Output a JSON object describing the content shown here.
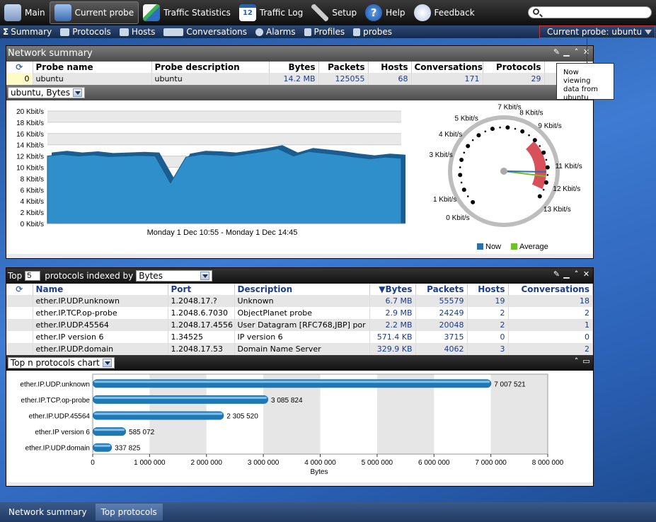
{
  "nav": {
    "items": [
      {
        "label": "Main",
        "icon": "house-icon"
      },
      {
        "label": "Current probe",
        "icon": "monitor-icon",
        "active": true
      },
      {
        "label": "Traffic Statistics",
        "icon": "chart-icon"
      },
      {
        "label": "Traffic Log",
        "icon": "calendar-icon"
      },
      {
        "label": "Setup",
        "icon": "wrench-icon"
      },
      {
        "label": "Help",
        "icon": "help-icon"
      },
      {
        "label": "Feedback",
        "icon": "speech-bubble-icon"
      }
    ],
    "search_placeholder": ""
  },
  "subnav": {
    "items": [
      {
        "label": "Summary",
        "icon": "sigma-icon"
      },
      {
        "label": "Protocols",
        "icon": "protocols-icon"
      },
      {
        "label": "Hosts",
        "icon": "hosts-icon"
      },
      {
        "label": "Conversations",
        "icon": "conversations-icon"
      },
      {
        "label": "Alarms",
        "icon": "alarm-clock-icon"
      },
      {
        "label": "Profiles",
        "icon": "profiles-icon"
      },
      {
        "label": "probes",
        "icon": "probes-icon"
      }
    ],
    "current_probe": "Current probe: ubuntu"
  },
  "tooltip": "Now viewing data from ubuntu",
  "network_summary": {
    "title": "Network summary",
    "columns": [
      "Probe name",
      "Probe description",
      "Bytes",
      "Packets",
      "Hosts",
      "Conversations",
      "Protocols"
    ],
    "row": {
      "index": "0",
      "name": "ubuntu",
      "description": "ubuntu",
      "bytes": "14.2 MB",
      "packets": "125055",
      "hosts": "68",
      "conversations": "171",
      "protocols": "29"
    },
    "selector": "ubuntu, Bytes",
    "area_chart": {
      "y_ticks": [
        "20 Kbit/s",
        "18 Kbit/s",
        "16 Kbit/s",
        "14 Kbit/s",
        "12 Kbit/s",
        "10 Kbit/s",
        "8 Kbit/s",
        "6 Kbit/s",
        "4 Kbit/s",
        "2 Kbit/s",
        "0 Kbit/s"
      ],
      "x_label": "Monday 1 Dec 10:55 - Monday 1 Dec 14:45",
      "values": [
        12,
        12.3,
        12,
        12.2,
        11.9,
        12,
        12.1,
        12,
        7.2,
        11.8,
        12.3,
        12.2,
        12.0,
        12.4,
        12.8,
        13.3,
        12,
        12.8,
        12.5,
        12.2,
        11.8,
        11.5,
        11.8,
        11.6
      ]
    },
    "gauge": {
      "labels": [
        "0 Kbit/s",
        "1 Kbit/s",
        "3 Kbit/s",
        "4 Kbit/s",
        "5 Kbit/s",
        "7 Kbit/s",
        "8 Kbit/s",
        "9 Kbit/s",
        "11 Kbit/s",
        "12 Kbit/s",
        "13 Kbit/s"
      ],
      "now": 11.3,
      "average": 11.6,
      "legend_now": "Now",
      "legend_average": "Average",
      "now_color": "#2b6fb0",
      "average_color": "#6fc12a"
    }
  },
  "top_protocols": {
    "prefix": "Top",
    "count": "5",
    "mid_label": "protocols indexed by",
    "indexed_by": "Bytes",
    "columns": [
      "Name",
      "Port",
      "Description",
      "Bytes",
      "Packets",
      "Hosts",
      "Conversations"
    ],
    "rows": [
      {
        "name": "ether.IP.UDP.unknown",
        "port": "1.2048.17.?",
        "description": "Unknown",
        "bytes": "6.7 MB",
        "packets": "55579",
        "hosts": "19",
        "conversations": "18"
      },
      {
        "name": "ether.IP.TCP.op-probe",
        "port": "1.2048.6.7030",
        "description": "ObjectPlanet probe",
        "bytes": "2.9 MB",
        "packets": "24249",
        "hosts": "2",
        "conversations": "2"
      },
      {
        "name": "ether.IP.UDP.45564",
        "port": "1.2048.17.4556",
        "description": "User Datagram [RFC768,JBP] por",
        "bytes": "2.2 MB",
        "packets": "20048",
        "hosts": "2",
        "conversations": "1"
      },
      {
        "name": "ether.IP version 6",
        "port": "1.34525",
        "description": "IP version 6",
        "bytes": "571.4 KB",
        "packets": "3715",
        "hosts": "0",
        "conversations": "0"
      },
      {
        "name": "ether.IP.UDP.domain",
        "port": "1.2048.17.53",
        "description": "Domain Name Server",
        "bytes": "329.9 KB",
        "packets": "4062",
        "hosts": "3",
        "conversations": "2"
      }
    ],
    "chart_selector": "Top n protocols chart"
  },
  "chart_data": {
    "type": "bar",
    "orientation": "horizontal",
    "categories": [
      "ether.IP.UDP.unknown",
      "ether.IP.TCP.op-probe",
      "ether.IP.UDP.45564",
      "ether.IP version 6",
      "ether.IP.UDP.domain"
    ],
    "values": [
      7007521,
      3085824,
      2305520,
      585072,
      337825
    ],
    "value_labels": [
      "7 007 521",
      "3 085 824",
      "2 305 520",
      "585 072",
      "337 825"
    ],
    "x_ticks": [
      "0",
      "1 000 000",
      "2 000 000",
      "3 000 000",
      "4 000 000",
      "5 000 000",
      "6 000 000",
      "7 000 000",
      "8 000 000"
    ],
    "xlim": [
      0,
      8000000
    ],
    "xlabel": "Bytes",
    "bar_color": "#1f78b4"
  },
  "bottom_tabs": [
    {
      "label": "Network summary",
      "active": false
    },
    {
      "label": "Top protocols",
      "active": true
    }
  ]
}
